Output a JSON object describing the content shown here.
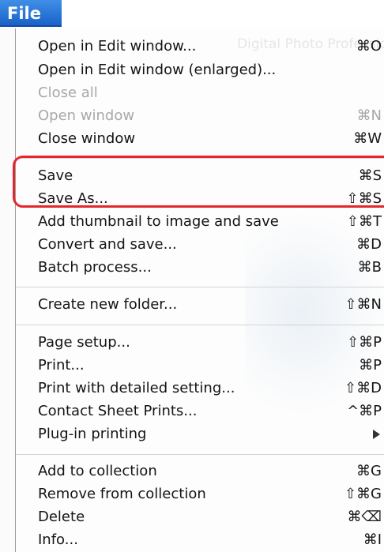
{
  "menu": {
    "title": "File",
    "watermark": "Digital Photo Professional",
    "items": [
      {
        "label": "Open in Edit window...",
        "shortcut": "⌘O",
        "enabled": true
      },
      {
        "label": "Open in Edit window (enlarged)...",
        "shortcut": "",
        "enabled": true
      },
      {
        "label": "Close all",
        "shortcut": "",
        "enabled": false
      },
      {
        "label": "Open window",
        "shortcut": "⌘N",
        "enabled": false
      },
      {
        "label": "Close window",
        "shortcut": "⌘W",
        "enabled": true
      },
      {
        "label": "Save",
        "shortcut": "⌘S",
        "enabled": true
      },
      {
        "label": "Save As...",
        "shortcut": "⇧⌘S",
        "enabled": true
      },
      {
        "label": "Add thumbnail to image and save",
        "shortcut": "⇧⌘T",
        "enabled": true
      },
      {
        "label": "Convert and save...",
        "shortcut": "⌘D",
        "enabled": true
      },
      {
        "label": "Batch process...",
        "shortcut": "⌘B",
        "enabled": true
      },
      {
        "label": "Create new folder...",
        "shortcut": "⇧⌘N",
        "enabled": true
      },
      {
        "label": "Page setup...",
        "shortcut": "⇧⌘P",
        "enabled": true
      },
      {
        "label": "Print...",
        "shortcut": "⌘P",
        "enabled": true
      },
      {
        "label": "Print with detailed setting...",
        "shortcut": "⇧⌘D",
        "enabled": true
      },
      {
        "label": "Contact Sheet Prints...",
        "shortcut": "^⌘P",
        "enabled": true
      },
      {
        "label": "Plug-in printing",
        "shortcut": "",
        "enabled": true,
        "submenu": true
      },
      {
        "label": "Add to collection",
        "shortcut": "⌘G",
        "enabled": true
      },
      {
        "label": "Remove from collection",
        "shortcut": "⇧⌘G",
        "enabled": true
      },
      {
        "label": "Delete",
        "shortcut": "⌘⌫",
        "enabled": true
      },
      {
        "label": "Info...",
        "shortcut": "⌘I",
        "enabled": true
      }
    ]
  },
  "colors": {
    "menu_title_bg": "#2a74d8",
    "highlight_outline": "#e5262c",
    "disabled_text": "#a8a8a8"
  },
  "icons": {
    "submenu_indicator": "submenu-arrow-icon"
  }
}
